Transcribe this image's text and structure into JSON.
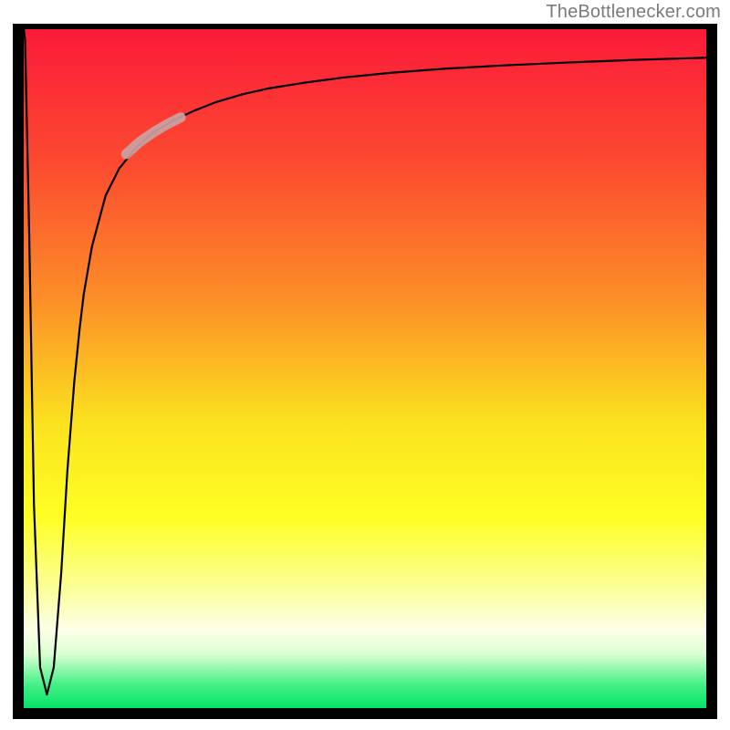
{
  "attribution": "TheBottlenecker.com",
  "chart_data": {
    "type": "line",
    "title": "",
    "xlabel": "",
    "ylabel": "",
    "xlim": [
      0,
      100
    ],
    "ylim": [
      0,
      100
    ],
    "background_gradient": {
      "stops": [
        {
          "offset": 0.0,
          "color": "#fb1a39"
        },
        {
          "offset": 0.2,
          "color": "#fc4b30"
        },
        {
          "offset": 0.4,
          "color": "#fc8f28"
        },
        {
          "offset": 0.58,
          "color": "#fbe21f"
        },
        {
          "offset": 0.72,
          "color": "#feff24"
        },
        {
          "offset": 0.83,
          "color": "#fbffa0"
        },
        {
          "offset": 0.885,
          "color": "#fdffe8"
        },
        {
          "offset": 0.92,
          "color": "#dcffd3"
        },
        {
          "offset": 0.965,
          "color": "#46f088"
        },
        {
          "offset": 1.0,
          "color": "#02e465"
        }
      ]
    },
    "series": [
      {
        "name": "main-curve",
        "color": "#000000",
        "width": 2.2,
        "x": [
          0.0,
          0.2,
          0.8,
          1.5,
          2.4,
          3.4,
          4.4,
          5.5,
          6.4,
          7.4,
          8.2,
          8.8,
          10.0,
          12.0,
          14.0,
          16.5,
          19.0,
          22.0,
          25.0,
          28.0,
          32.0,
          36.0,
          41.0,
          47.0,
          54.0,
          62.0,
          71.0,
          80.0,
          90.0,
          100.0
        ],
        "y": [
          100.0,
          98.5,
          70.0,
          30.0,
          6.0,
          2.0,
          6.0,
          20.0,
          35.0,
          48.0,
          56.0,
          61.0,
          68.0,
          75.5,
          79.5,
          82.6,
          84.8,
          86.6,
          88.0,
          89.2,
          90.4,
          91.3,
          92.1,
          92.9,
          93.6,
          94.2,
          94.7,
          95.1,
          95.5,
          95.8
        ]
      },
      {
        "name": "highlight-band",
        "color": "#caa2a1",
        "width": 11,
        "opacity": 0.92,
        "x": [
          15.0,
          17.0,
          19.0,
          21.0,
          23.0
        ],
        "y": [
          81.6,
          83.4,
          84.8,
          86.0,
          87.0
        ]
      }
    ]
  }
}
